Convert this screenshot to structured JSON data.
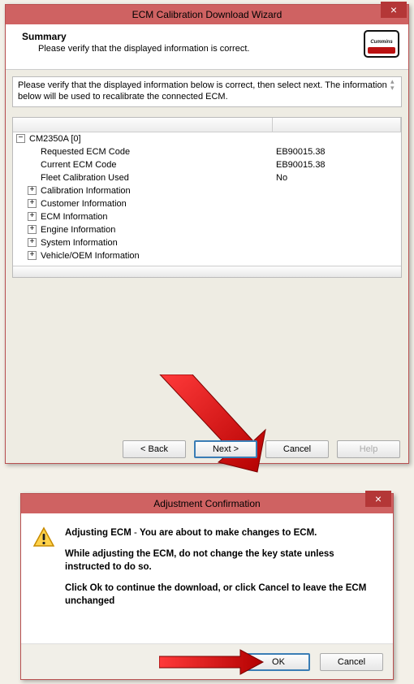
{
  "wizard": {
    "title": "ECM Calibration Download Wizard",
    "close_glyph": "×",
    "summary_title": "Summary",
    "summary_sub": "Please verify that the displayed information is correct.",
    "logo_name": "cummins-logo",
    "instruction": "Please verify that the displayed information below is correct, then select next. The information below will be used to recalibrate the connected ECM.",
    "tree": {
      "root": {
        "label": "CM2350A [0]",
        "expander": "−"
      },
      "leaves": [
        {
          "label": "Requested ECM Code",
          "value": "EB90015.38"
        },
        {
          "label": "Current ECM Code",
          "value": "EB90015.38"
        },
        {
          "label": "Fleet Calibration Used",
          "value": "No"
        }
      ],
      "branches": [
        {
          "label": "Calibration Information",
          "expander": "+"
        },
        {
          "label": "Customer Information",
          "expander": "+"
        },
        {
          "label": "ECM Information",
          "expander": "+"
        },
        {
          "label": "Engine Information",
          "expander": "+"
        },
        {
          "label": "System Information",
          "expander": "+"
        },
        {
          "label": "Vehicle/OEM Information",
          "expander": "+"
        }
      ]
    },
    "buttons": {
      "back": "< Back",
      "next": "Next >",
      "cancel": "Cancel",
      "help": "Help"
    }
  },
  "dialog": {
    "title": "Adjustment Confirmation",
    "close_glyph": "×",
    "line1_a": "Adjusting ECM",
    "line1_b": " - ",
    "line1_c": "You are about to make changes to ECM.",
    "line2": "While adjusting the ECM, do not change the key state unless instructed to do so.",
    "line3": "Click Ok to continue the download, or click Cancel to leave the ECM unchanged",
    "buttons": {
      "ok": "OK",
      "cancel": "Cancel"
    }
  }
}
